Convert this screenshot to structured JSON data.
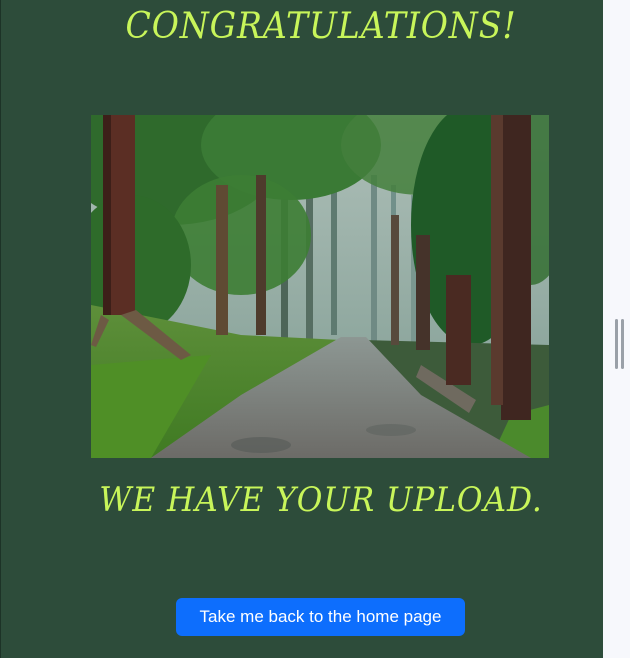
{
  "heading": "CONGRATULATIONS!",
  "message": "WE HAVE YOUR UPLOAD.",
  "image": {
    "subject": "misty forest path"
  },
  "home_button_label": "Take me back to the home page",
  "colors": {
    "panel_background": "#2d4c3a",
    "heading_text": "#c8f55a",
    "button_background": "#0d6efd",
    "button_text": "#ffffff"
  }
}
